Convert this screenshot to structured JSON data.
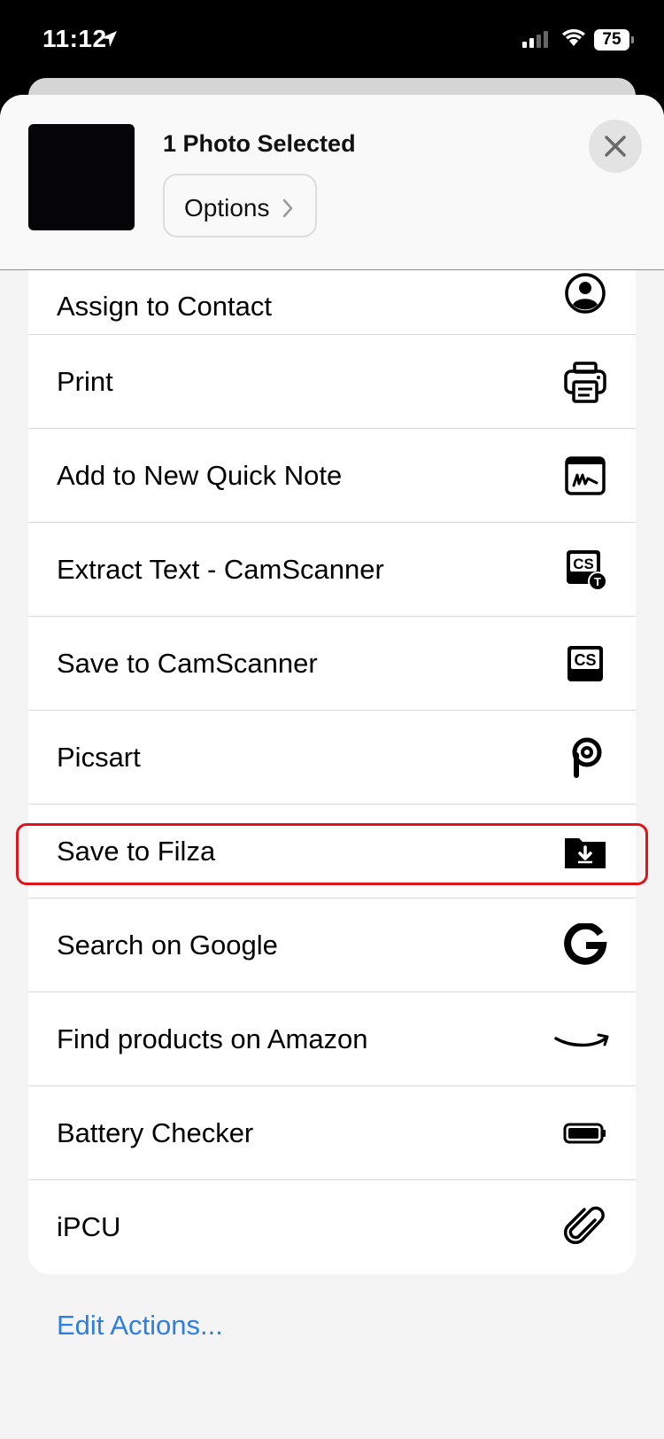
{
  "status": {
    "time": "11:12",
    "battery": "75"
  },
  "header": {
    "title": "1 Photo Selected",
    "options_label": "Options"
  },
  "actions": [
    {
      "label": "Assign to Contact",
      "icon": "contact-icon"
    },
    {
      "label": "Print",
      "icon": "printer-icon"
    },
    {
      "label": "Add to New Quick Note",
      "icon": "quick-note-icon"
    },
    {
      "label": "Extract Text - CamScanner",
      "icon": "camscanner-text-icon"
    },
    {
      "label": "Save to CamScanner",
      "icon": "camscanner-icon"
    },
    {
      "label": "Picsart",
      "icon": "picsart-icon"
    },
    {
      "label": "Save to Filza",
      "icon": "folder-download-icon"
    },
    {
      "label": "Search on Google",
      "icon": "google-icon"
    },
    {
      "label": "Find products on Amazon",
      "icon": "amazon-icon"
    },
    {
      "label": "Battery Checker",
      "icon": "battery-icon"
    },
    {
      "label": "iPCU",
      "icon": "paperclip-icon"
    }
  ],
  "footer": {
    "edit_actions": "Edit Actions..."
  },
  "colors": {
    "highlight": "#e0141c",
    "link": "#2f7fe0"
  }
}
